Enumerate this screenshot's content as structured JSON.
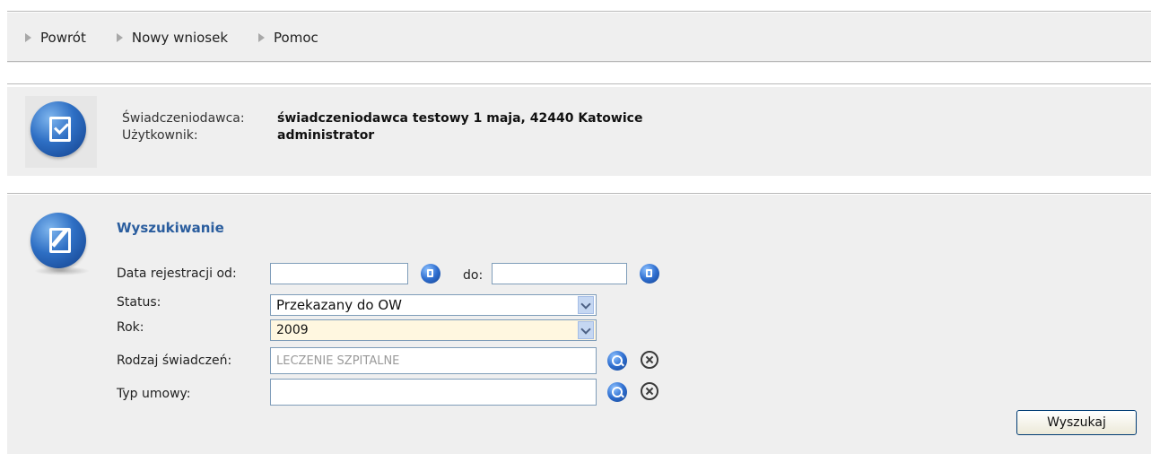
{
  "nav": {
    "items": [
      {
        "label": "Powrót"
      },
      {
        "label": "Nowy wniosek"
      },
      {
        "label": "Pomoc"
      }
    ]
  },
  "user_info": {
    "provider_label": "Świadczeniodawca:",
    "provider_value": "świadczeniodawca testowy 1 maja, 42440 Katowice",
    "user_label": "Użytkownik:",
    "user_value": "administrator"
  },
  "search": {
    "title": "Wyszukiwanie",
    "date_from_label": "Data rejestracji od:",
    "date_from_value": "",
    "date_to_label": "do:",
    "date_to_value": "",
    "status_label": "Status:",
    "status_selected": "Przekazany do OW",
    "year_label": "Rok:",
    "year_selected": "2009",
    "benefit_label": "Rodzaj świadczeń:",
    "benefit_value": "LECZENIE SZPITALNE",
    "contract_label": "Typ umowy:",
    "contract_value": "",
    "submit_label": "Wyszukaj"
  },
  "icons": {
    "user_panel": "document-check-icon",
    "search_panel": "document-edit-icon",
    "calendar": "calendar-icon",
    "search": "search-icon",
    "clear": "clear-icon"
  },
  "colors": {
    "panel_bg": "#efefef",
    "title": "#2a5d9e",
    "select_highlight": "#fff7e0"
  }
}
